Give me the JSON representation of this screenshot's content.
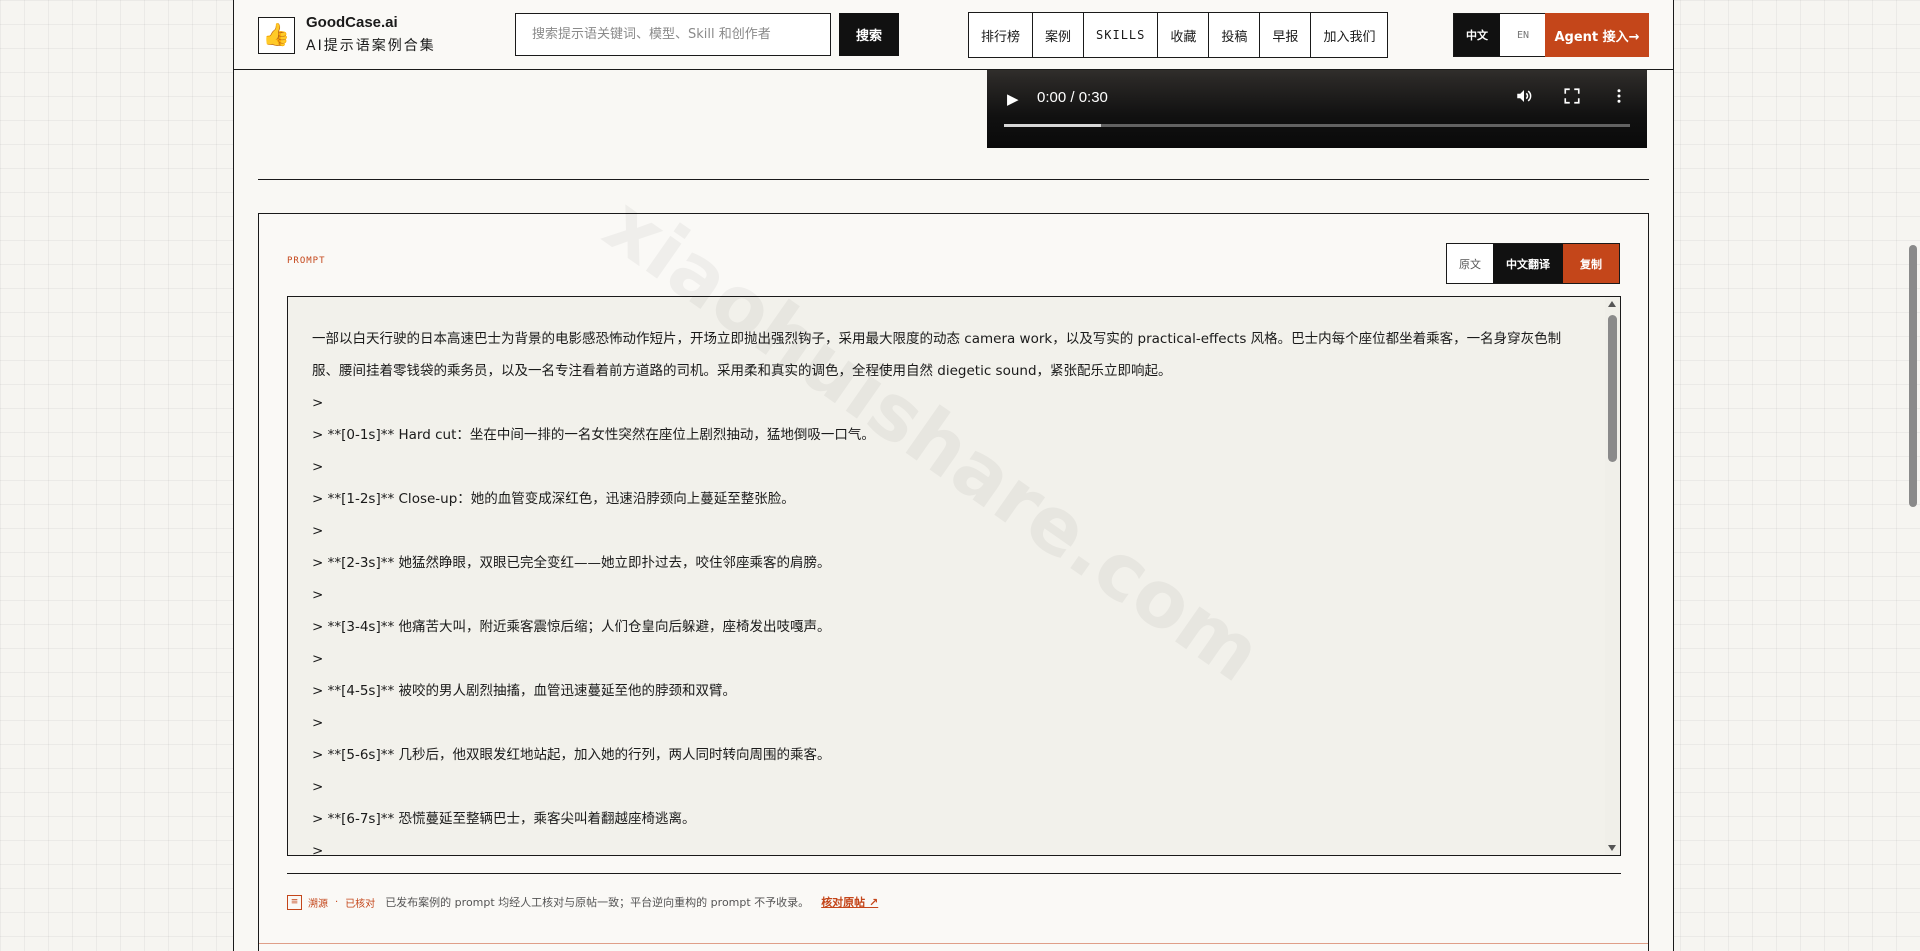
{
  "header": {
    "brand_name": "GoodCase.ai",
    "brand_sub": "AI提示语案例合集",
    "search_placeholder": "搜索提示语关键词、模型、Skill 和创作者",
    "search_button": "搜索",
    "nav": [
      "排行榜",
      "案例",
      "SKILLS",
      "收藏",
      "投稿",
      "早报",
      "加入我们"
    ],
    "lang_zh": "中文",
    "lang_en": "EN",
    "agent_button": "Agent 接入→"
  },
  "video": {
    "time": "0:00 / 0:30",
    "buffered_fraction": 0.155
  },
  "prompt": {
    "label": "PROMPT",
    "toggle_original": "原文",
    "toggle_translation": "中文翻译",
    "copy_button": "复制",
    "lines": [
      "一部以白天行驶的日本高速巴士为背景的电影感恐怖动作短片，开场立即抛出强烈钩子，采用最大限度的动态 camera work，以及写实的 practical-effects 风格。巴士内每个座位都坐着乘客，一名身穿灰色制服、腰间挂着零钱袋的乘务员，以及一名专注看着前方道路的司机。采用柔和真实的调色，全程使用自然 diegetic sound，紧张配乐立即响起。",
      ">",
      "> **[0-1s]** Hard cut：坐在中间一排的一名女性突然在座位上剧烈抽动，猛地倒吸一口气。",
      ">",
      "> **[1-2s]** Close-up：她的血管变成深红色，迅速沿脖颈向上蔓延至整张脸。",
      ">",
      "> **[2-3s]** 她猛然睁眼，双眼已完全变红——她立即扑过去，咬住邻座乘客的肩膀。",
      ">",
      "> **[3-4s]** 他痛苦大叫，附近乘客震惊后缩；人们仓皇向后躲避，座椅发出吱嘎声。",
      ">",
      "> **[4-5s]** 被咬的男人剧烈抽搐，血管迅速蔓延至他的脖颈和双臂。",
      ">",
      "> **[5-6s]** 几秒后，他双眼发红地站起，加入她的行列，两人同时转向周围的乘客。",
      ">",
      "> **[6-7s]** 恐慌蔓延至整辆巴士，乘客尖叫着翻越座椅逃离。",
      ">"
    ]
  },
  "footnote": {
    "source": "溯源",
    "dot": "·",
    "verified": "已核对",
    "note": "已发布案例的 prompt 均经人工核对与原帖一致；平台逆向重构的 prompt 不予收录。",
    "link": "核对原帖 ↗"
  },
  "watermark": "xiaohuishare.com",
  "colors": {
    "accent": "#c4461a",
    "dark": "#111111",
    "background": "#f9f8f4"
  }
}
